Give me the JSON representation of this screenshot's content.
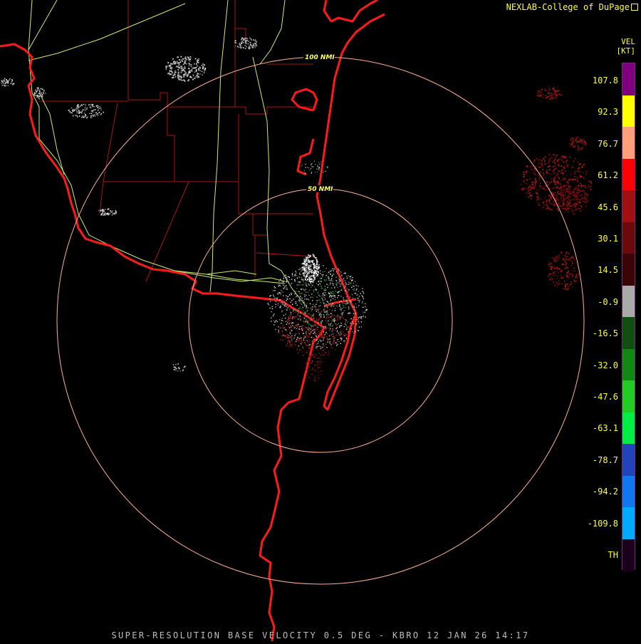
{
  "header": {
    "credit": "NEXLAB-College of DuPage"
  },
  "footer": {
    "product": "SUPER-RESOLUTION BASE VELOCITY 0.5 DEG - KBRO 12 JAN 26 14:17"
  },
  "legend": {
    "product_code": "VEL",
    "units": "[KT]",
    "labels": [
      "107.8",
      "92.3",
      "76.7",
      "61.2",
      "45.6",
      "30.1",
      "14.5",
      "-0.9",
      "-16.5",
      "-32.0",
      "-47.6",
      "-63.1",
      "-78.7",
      "-94.2",
      "-109.8",
      "TH"
    ],
    "colors": [
      "#7f007f",
      "#ffff00",
      "#ffa07a",
      "#ff0000",
      "#a01010",
      "#6a0a0a",
      "#3a0505",
      "#aaaaaa",
      "#0f4f0f",
      "#118811",
      "#22cc22",
      "#00ee44",
      "#2244bb",
      "#1177ee",
      "#00aaff",
      "#1a001a"
    ]
  },
  "range_rings": [
    {
      "label": "100 NMI"
    },
    {
      "label": "50 NMI"
    }
  ],
  "map": {
    "coastline_color": "#ff1a1a",
    "county_line_color": "#aa1515",
    "highway_color": "#ccee66",
    "ring_color": "#ffb090"
  }
}
